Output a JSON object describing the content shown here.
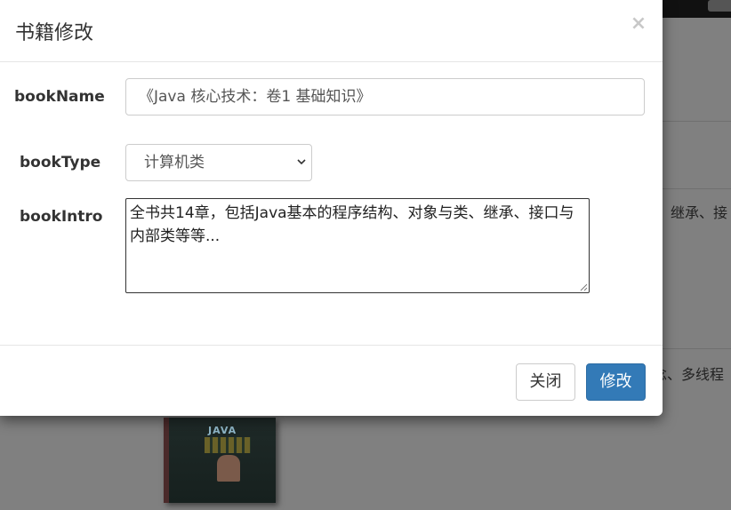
{
  "modal": {
    "title": "书籍修改",
    "close_symbol": "×",
    "fields": {
      "book_name_label": "bookName",
      "book_name_value": "《Java 核心技术：卷1 基础知识》",
      "book_type_label": "bookType",
      "book_type_selected": "计算机类",
      "book_intro_label": "bookIntro",
      "book_intro_value": "全书共14章，包括Java基本的程序结构、对象与类、继承、接口与内部类等等..."
    },
    "footer": {
      "close_label": "关闭",
      "save_label": "修改"
    }
  },
  "background": {
    "row1_text_fragment": "继承、接",
    "row2_text_fragment": "念、多线程",
    "book_cover_title": "JAVA"
  },
  "colors": {
    "primary": "#337ab7",
    "overlay": "#808080"
  },
  "icons": {
    "select_arrow": "chevron-down-icon",
    "resize": "resize-handle-icon"
  }
}
